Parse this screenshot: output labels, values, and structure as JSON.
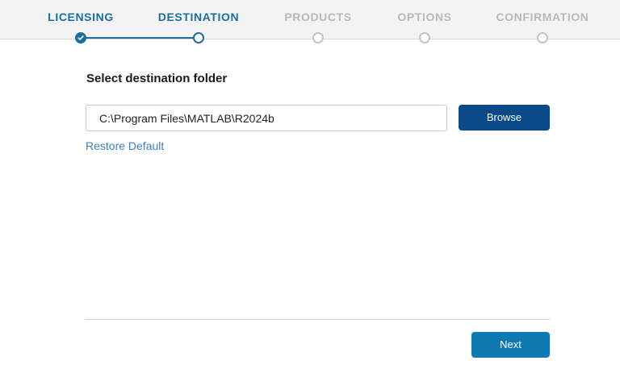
{
  "stepper": {
    "steps": [
      {
        "label": "LICENSING",
        "state": "done"
      },
      {
        "label": "DESTINATION",
        "state": "current"
      },
      {
        "label": "PRODUCTS",
        "state": "todo"
      },
      {
        "label": "OPTIONS",
        "state": "todo"
      },
      {
        "label": "CONFIRMATION",
        "state": "todo"
      }
    ]
  },
  "main": {
    "title": "Select destination folder",
    "folder_path": "C:\\Program Files\\MATLAB\\R2024b",
    "browse_label": "Browse",
    "restore_label": "Restore Default"
  },
  "footer": {
    "next_label": "Next"
  },
  "colors": {
    "accent": "#1a6f9b",
    "browse_button": "#0b4a8a",
    "next_button": "#0f7ab1",
    "link": "#3f7fb8",
    "inactive_step": "#b9b9b9"
  },
  "icons": {
    "done_step": "checkmark-icon"
  }
}
